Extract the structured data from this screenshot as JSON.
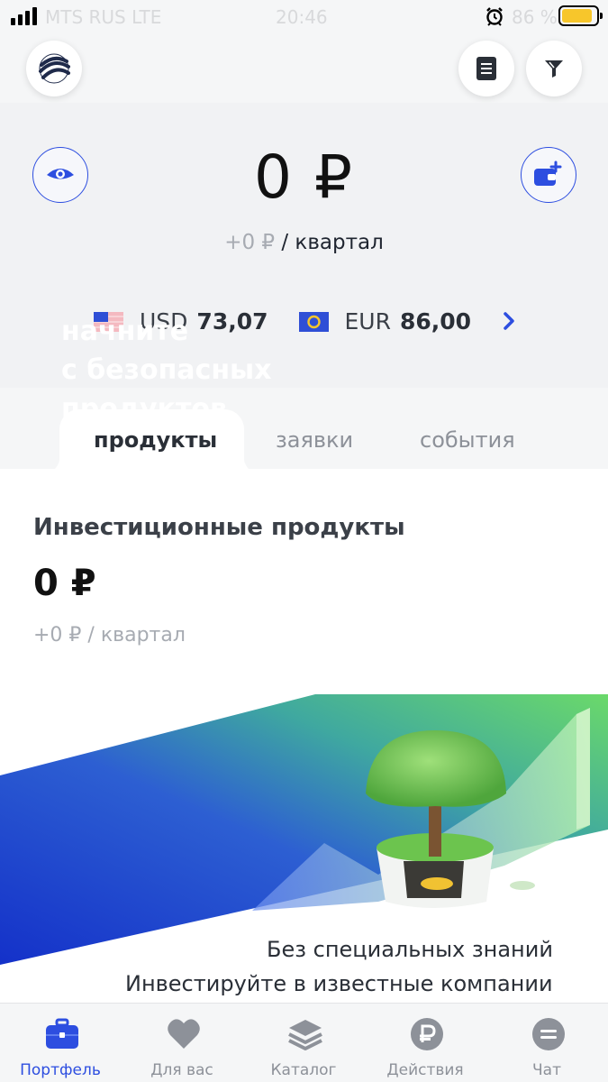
{
  "status_bar": {
    "carrier": "MTS RUS  LTE",
    "time": "20:46",
    "battery_pct": "86 %",
    "battery_color": "#f7c62b"
  },
  "top_nav": {
    "logo_icon": "globe-logo-icon",
    "doc_icon": "document-icon",
    "filter_icon": "filter-icon"
  },
  "summary": {
    "total": "0 ₽",
    "quarter_change": "+0 ₽",
    "quarter_label": "/ квартал",
    "eye_icon": "eye-icon",
    "wallet_icon": "wallet-add-icon",
    "rates": [
      {
        "code": "USD",
        "value": "73,07",
        "flag": "us-flag-icon"
      },
      {
        "code": "EUR",
        "value": "86,00",
        "flag": "eu-flag-icon"
      }
    ],
    "accent_color": "#2d4ee0"
  },
  "tabs": [
    {
      "label": "продукты",
      "active": true
    },
    {
      "label": "заявки",
      "active": false
    },
    {
      "label": "события",
      "active": false
    }
  ],
  "products": {
    "title": "Инвестиционные продукты",
    "amount": "0 ₽",
    "quarter_change": "+0 ₽",
    "quarter_label": "/ квартал"
  },
  "banner": {
    "headline_1": "начните",
    "headline_2": "с безопасных",
    "headline_3": "продуктов",
    "line_1": "Без специальных знаний",
    "line_2": "Инвестируйте в известные компании",
    "icon": "money-tree-illustration"
  },
  "tabbar": [
    {
      "label": "Портфель",
      "icon": "briefcase-icon",
      "active": true
    },
    {
      "label": "Для вас",
      "icon": "heart-icon",
      "active": false
    },
    {
      "label": "Каталог",
      "icon": "layers-icon",
      "active": false
    },
    {
      "label": "Действия",
      "icon": "ruble-icon",
      "active": false
    },
    {
      "label": "Чат",
      "icon": "chat-icon",
      "active": false
    }
  ]
}
